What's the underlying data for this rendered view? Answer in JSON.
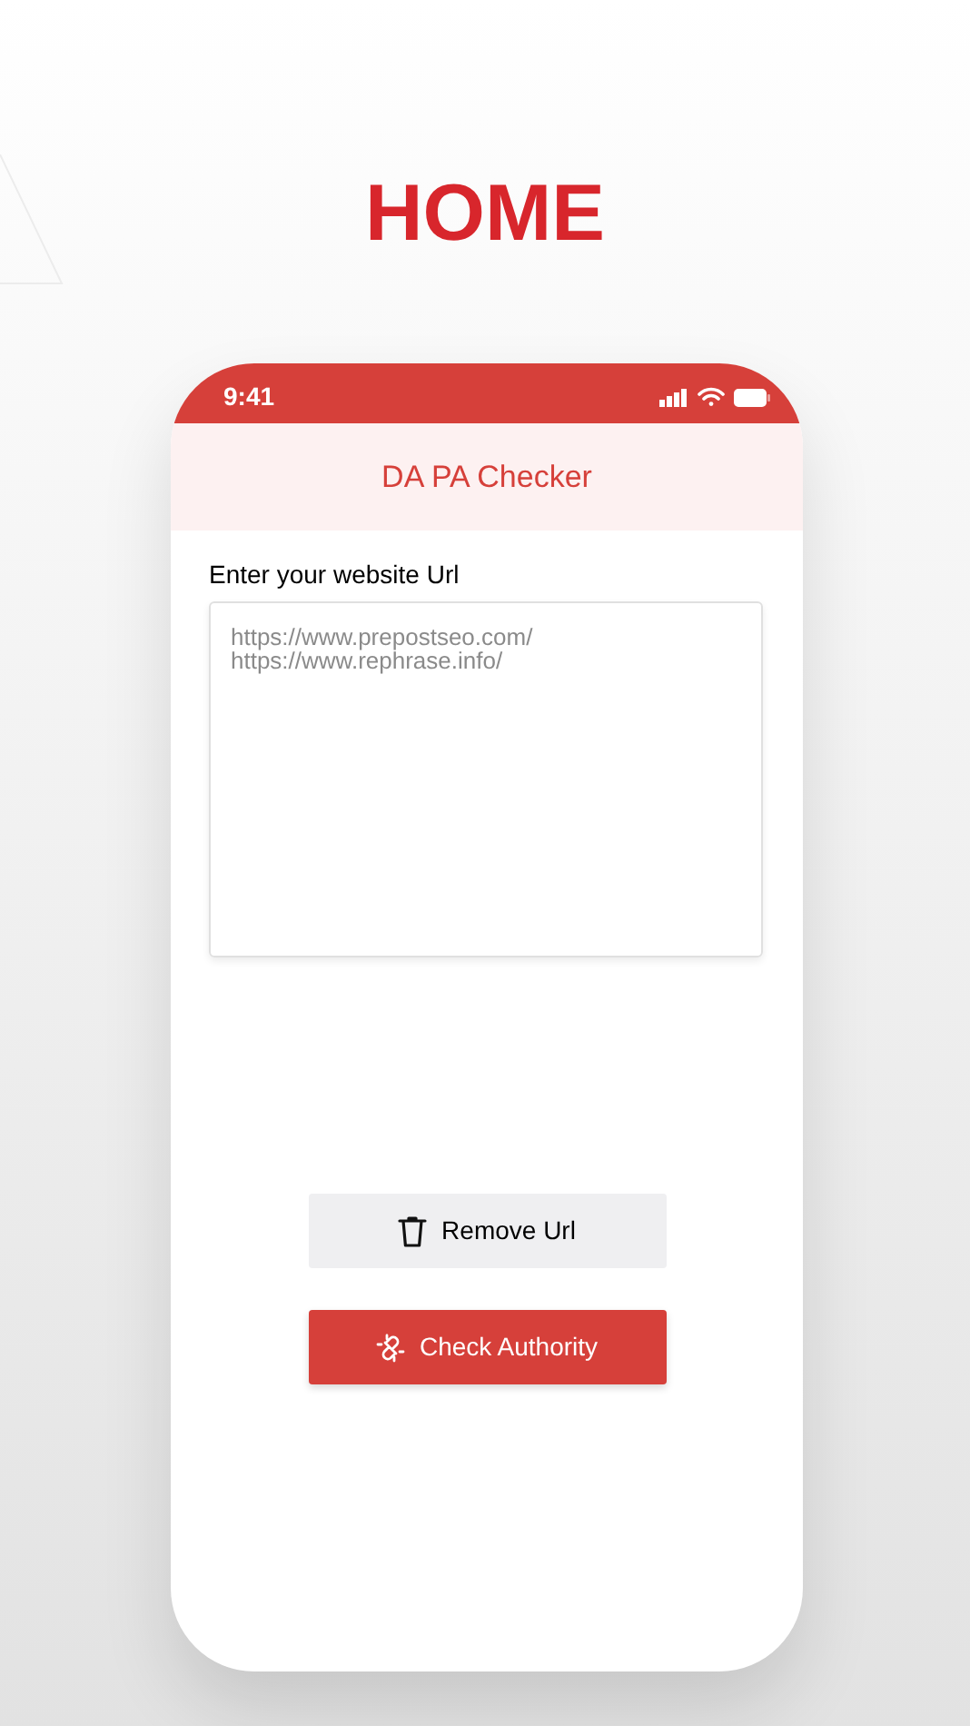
{
  "page_title": "HOME",
  "status_bar": {
    "time": "9:41"
  },
  "app_bar": {
    "title": "DA PA Checker"
  },
  "url_field": {
    "label": "Enter your website Url",
    "placeholder": "https://www.prepostseo.com/\nhttps://www.rephrase.info/"
  },
  "buttons": [
    {
      "kind": "remove",
      "label": "Remove Url"
    },
    {
      "kind": "check",
      "label": "Check Authority"
    }
  ]
}
